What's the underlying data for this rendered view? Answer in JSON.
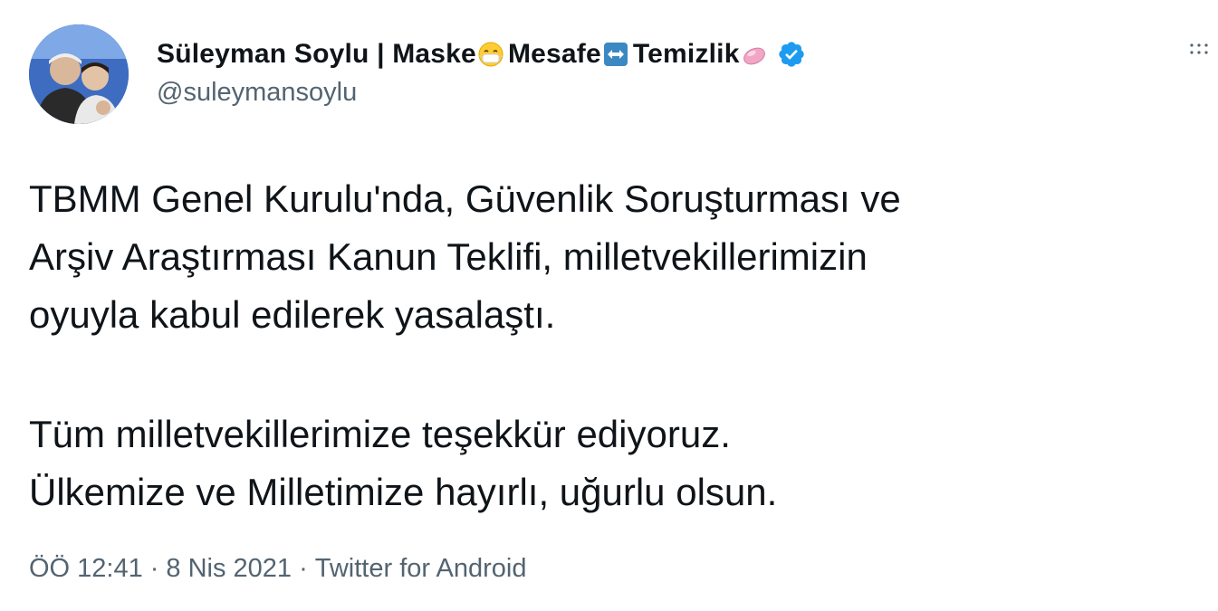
{
  "author": {
    "name": "Süleyman Soylu | Maske",
    "name_part2": "Mesafe",
    "name_part3": "Temizlik",
    "emoji_1": "mask-face-emoji",
    "emoji_2": "left-right-arrow-emoji",
    "emoji_3": "soap-emoji",
    "verified": true,
    "handle": "@suleymansoylu"
  },
  "tweet": {
    "lines": [
      "TBMM Genel Kurulu'nda, Güvenlik Soruşturması ve",
      "Arşiv Araştırması Kanun Teklifi, milletvekillerimizin",
      "oyuyla kabul edilerek yasalaştı.",
      "Tüm milletvekillerimize teşekkür ediyoruz.",
      "Ülkemize ve Milletimize hayırlı, uğurlu olsun."
    ]
  },
  "meta": {
    "time": "ÖÖ 12:41",
    "separator": "·",
    "date": "8 Nis 2021",
    "source": "Twitter for Android"
  },
  "colors": {
    "text": "#0f1419",
    "secondary": "#536471",
    "verified": "#1d9bf0"
  }
}
